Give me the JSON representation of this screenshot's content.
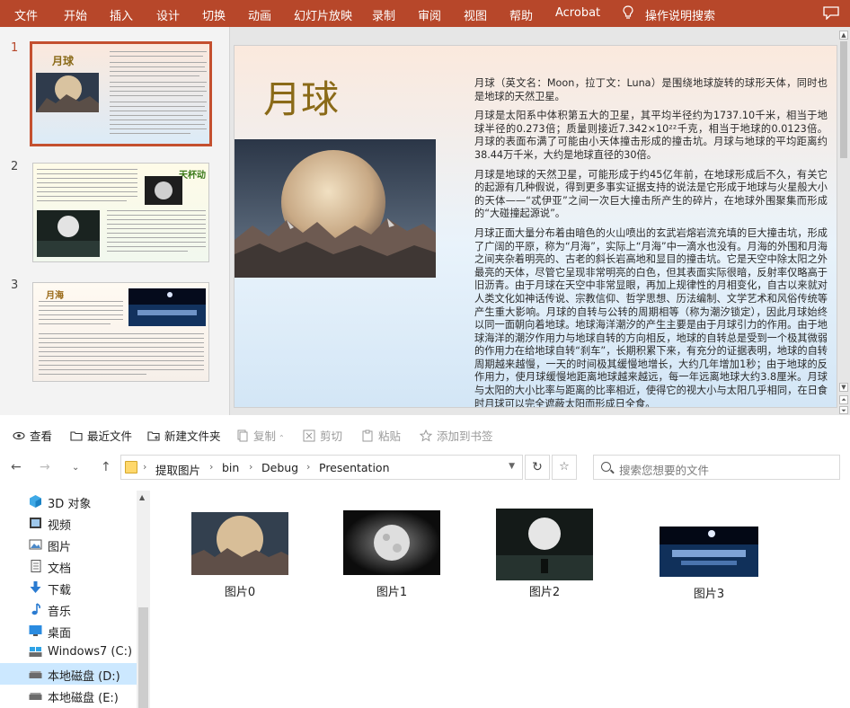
{
  "ribbon": {
    "tabs": [
      "文件",
      "开始",
      "插入",
      "设计",
      "切换",
      "动画",
      "幻灯片放映",
      "录制",
      "审阅",
      "视图",
      "帮助",
      "Acrobat"
    ],
    "tell_me": "操作说明搜索",
    "colors": {
      "ribbon": "#b7472a",
      "selection": "#c4502f"
    }
  },
  "slide_panel": {
    "numbers": [
      "1",
      "2",
      "3"
    ],
    "thumb1_title": "月球",
    "thumb2_title": "天杯动",
    "thumb3_title": "月海"
  },
  "slide": {
    "title": "月球",
    "paragraphs": [
      "月球（英文名：Moon，拉丁文：Luna）是围绕地球旋转的球形天体，同时也是地球的天然卫星。",
      "月球是太阳系中体积第五大的卫星，其平均半径约为1737.10千米，相当于地球半径的0.273倍；质量则接近7.342×10²²千克，相当于地球的0.0123倍。月球的表面布满了可能由小天体撞击形成的撞击坑。月球与地球的平均距离约38.44万千米，大约是地球直径的30倍。",
      "月球是地球的天然卫星，可能形成于约45亿年前，在地球形成后不久，有关它的起源有几种假说，得到更多事实证据支持的说法是它形成于地球与火星般大小的天体——“忒伊亚”之间一次巨大撞击所产生的碎片，在地球外围聚集而形成的“大碰撞起源说”。",
      "月球正面大量分布着由暗色的火山喷出的玄武岩熔岩流充填的巨大撞击坑，形成了广阔的平原，称为“月海”，实际上“月海”中一滴水也没有。月海的外围和月海之间夹杂着明亮的、古老的斜长岩高地和显目的撞击坑。它是天空中除太阳之外最亮的天体，尽管它呈现非常明亮的白色，但其表面实际很暗，反射率仅略高于旧沥青。由于月球在天空中非常显眼，再加上规律性的月相变化，自古以来就对人类文化如神话传说、宗教信仰、哲学思想、历法编制、文学艺术和风俗传统等产生重大影响。月球的自转与公转的周期相等（称为潮汐锁定），因此月球始终以同一面朝向着地球。地球海洋潮汐的产生主要是由于月球引力的作用。由于地球海洋的潮汐作用力与地球自转的方向相反，地球的自转总是受到一个极其微弱的作用力在给地球自转“刹车”，长期积累下来，有充分的证据表明，地球的自转周期越来越慢，一天的时间极其缓慢地增长，大约几年增加1秒；由于地球的反作用力，使月球缓慢地距离地球越来越远，每一年远离地球大约3.8厘米。月球与太阳的大小比率与距离的比率相近，使得它的视大小与太阳几乎相同，在日食时月球可以完全遮蔽太阳而形成日全食。"
    ]
  },
  "explorer": {
    "toolbar": {
      "view": "查看",
      "recent": "最近文件",
      "new_folder": "新建文件夹",
      "copy": "复制",
      "cut": "剪切",
      "paste": "粘贴",
      "bookmark": "添加到书签"
    },
    "breadcrumb": [
      "提取图片",
      "bin",
      "Debug",
      "Presentation"
    ],
    "search_placeholder": "搜索您想要的文件",
    "nav": [
      {
        "label": "3D 对象",
        "icon": "3d-objects-icon"
      },
      {
        "label": "视频",
        "icon": "video-icon"
      },
      {
        "label": "图片",
        "icon": "pictures-icon"
      },
      {
        "label": "文档",
        "icon": "documents-icon"
      },
      {
        "label": "下载",
        "icon": "download-icon"
      },
      {
        "label": "音乐",
        "icon": "music-icon"
      },
      {
        "label": "桌面",
        "icon": "desktop-icon"
      },
      {
        "label": "Windows7 (C:)",
        "icon": "drive-icon"
      },
      {
        "label": "本地磁盘 (D:)",
        "icon": "drive-icon",
        "selected": true
      },
      {
        "label": "本地磁盘 (E:)",
        "icon": "drive-icon"
      }
    ],
    "files": [
      "图片0",
      "图片1",
      "图片2",
      "图片3"
    ]
  }
}
